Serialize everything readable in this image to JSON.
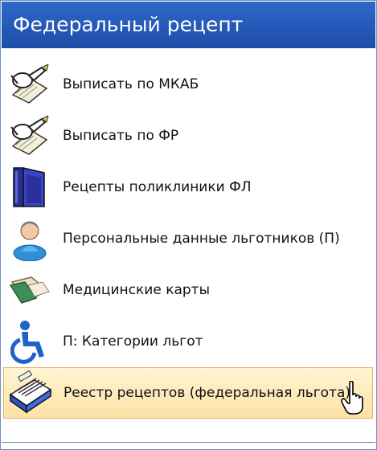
{
  "header": {
    "title": "Федеральный рецепт"
  },
  "items": [
    {
      "label": "Выписать по МКАБ",
      "icon": "writing-hand-icon"
    },
    {
      "label": "Выписать по ФР",
      "icon": "writing-hand-icon"
    },
    {
      "label": "Рецепты поликлиники ФЛ",
      "icon": "book-folder-icon"
    },
    {
      "label": "Персональные данные льготников (П)",
      "icon": "person-icon"
    },
    {
      "label": "Медицинские карты",
      "icon": "medical-card-icon"
    },
    {
      "label": "П: Категории льгот",
      "icon": "wheelchair-icon"
    },
    {
      "label": "Реестр рецептов (федеральная льгота)",
      "icon": "card-file-icon",
      "selected": true
    }
  ],
  "colors": {
    "header_bg": "#2459b8",
    "selected_bg": "#fde2a6"
  }
}
